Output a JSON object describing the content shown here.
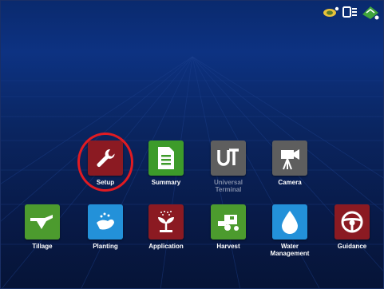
{
  "status_bar": {
    "icons": [
      "gps-satellite-icon",
      "display-status-icon",
      "radio-signal-icon"
    ]
  },
  "apps": {
    "row1": [
      {
        "label": "Setup",
        "icon": "wrench-icon",
        "color": "#8b1a22",
        "enabled": true,
        "highlighted": true
      },
      {
        "label": "Summary",
        "icon": "document-icon",
        "color": "#3d9b2a",
        "enabled": true
      },
      {
        "label": "Universal\nTerminal",
        "icon": "ut-icon",
        "color": "#5e5e5e",
        "enabled": false
      },
      {
        "label": "Camera",
        "icon": "camera-icon",
        "color": "#5e5e5e",
        "enabled": true
      }
    ],
    "row2": [
      {
        "label": "Tillage",
        "icon": "plow-icon",
        "color": "#4c9b2e",
        "enabled": true
      },
      {
        "label": "Planting",
        "icon": "seed-hand-icon",
        "color": "#2391d9",
        "enabled": true
      },
      {
        "label": "Application",
        "icon": "sprout-spray-icon",
        "color": "#8b1a22",
        "enabled": true
      },
      {
        "label": "Harvest",
        "icon": "combine-icon",
        "color": "#4c9b2e",
        "enabled": true
      },
      {
        "label": "Water\nManagement",
        "icon": "water-drop-icon",
        "color": "#2391d9",
        "enabled": true
      },
      {
        "label": "Guidance",
        "icon": "steering-wheel-icon",
        "color": "#8b1a22",
        "enabled": true
      }
    ]
  },
  "colors": {
    "highlight": "#e11b22",
    "background": "#0a2560"
  }
}
